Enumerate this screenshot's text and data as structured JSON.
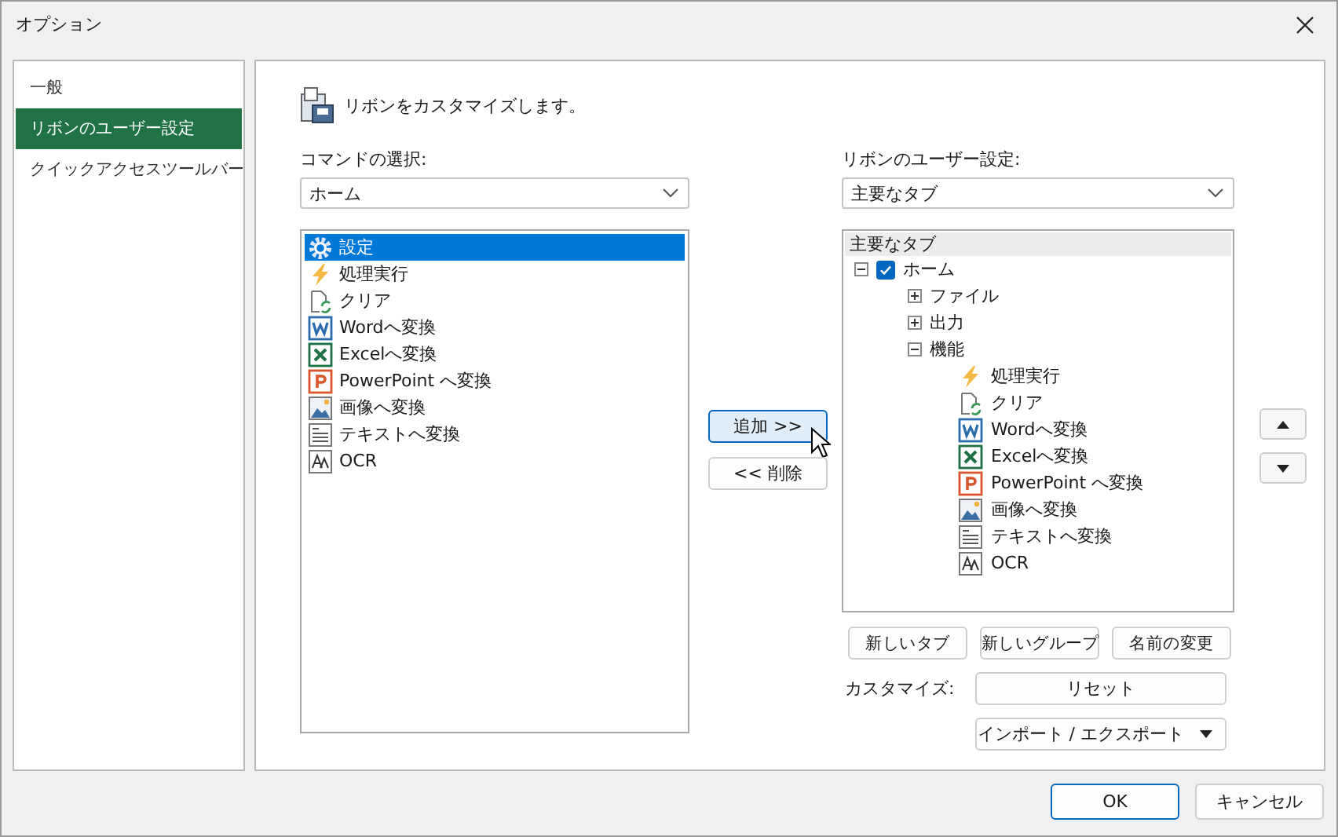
{
  "window": {
    "title": "オプション"
  },
  "sidebar": {
    "items": [
      {
        "label": "一般",
        "selected": false
      },
      {
        "label": "リボンのユーザー設定",
        "selected": true
      },
      {
        "label": "クイックアクセスツールバー",
        "selected": false
      }
    ]
  },
  "header": {
    "text": "リボンをカスタマイズします。"
  },
  "commands": {
    "label": "コマンドの選択:",
    "dropdown": {
      "value": "ホーム"
    },
    "items": [
      {
        "label": "設定",
        "kind": "settings",
        "selected": true
      },
      {
        "label": "処理実行",
        "kind": "run",
        "selected": false
      },
      {
        "label": "クリア",
        "kind": "clear",
        "selected": false
      },
      {
        "label": "Wordへ変換",
        "kind": "word",
        "selected": false
      },
      {
        "label": "Excelへ変換",
        "kind": "excel",
        "selected": false
      },
      {
        "label": "PowerPoint へ変換",
        "kind": "powerpoint",
        "selected": false
      },
      {
        "label": "画像へ変換",
        "kind": "image",
        "selected": false
      },
      {
        "label": "テキストへ変換",
        "kind": "text",
        "selected": false
      },
      {
        "label": "OCR",
        "kind": "ocr",
        "selected": false
      }
    ]
  },
  "move_buttons": [
    {
      "label": "追加 >>",
      "hovered": true
    },
    {
      "label": "<< 削除",
      "hovered": false
    }
  ],
  "ribbon": {
    "label": "リボンのユーザー設定:",
    "dropdown": {
      "value": "主要なタブ"
    },
    "tree": {
      "header": "主要なタブ",
      "items": [
        {
          "label": "ホーム",
          "expanded": true,
          "checked": true,
          "children": [
            {
              "label": "ファイル",
              "expanded": false
            },
            {
              "label": "出力",
              "expanded": false
            },
            {
              "label": "機能",
              "expanded": true,
              "children": [
                {
                  "label": "処理実行",
                  "kind": "run"
                },
                {
                  "label": "クリア",
                  "kind": "clear"
                },
                {
                  "label": "Wordへ変換",
                  "kind": "word"
                },
                {
                  "label": "Excelへ変換",
                  "kind": "excel"
                },
                {
                  "label": "PowerPoint へ変換",
                  "kind": "powerpoint"
                },
                {
                  "label": "画像へ変換",
                  "kind": "image"
                },
                {
                  "label": "テキストへ変換",
                  "kind": "text"
                },
                {
                  "label": "OCR",
                  "kind": "ocr"
                }
              ]
            }
          ]
        }
      ]
    },
    "buttons": [
      "新しいタブ",
      "新しいグループ",
      "名前の変更"
    ],
    "customize": {
      "label": "カスタマイズ:",
      "reset": "リセット",
      "import_export": "インポート / エクスポート"
    }
  },
  "footer": {
    "buttons": [
      {
        "label": "OK",
        "default": true
      },
      {
        "label": "キャンセル",
        "default": false
      }
    ]
  }
}
